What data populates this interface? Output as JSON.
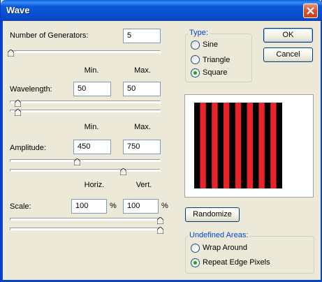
{
  "window": {
    "title": "Wave"
  },
  "generators": {
    "label": "Number of Generators:",
    "value": "5"
  },
  "col_minmax": {
    "min": "Min.",
    "max": "Max."
  },
  "wavelength": {
    "label": "Wavelength:",
    "min": "50",
    "max": "50"
  },
  "amplitude": {
    "label": "Amplitude:",
    "min": "450",
    "max": "750"
  },
  "col_scale": {
    "horiz": "Horiz.",
    "vert": "Vert."
  },
  "scale": {
    "label": "Scale:",
    "horiz": "100",
    "vert": "100",
    "unit": "%"
  },
  "type_group": {
    "title": "Type:",
    "options": [
      "Sine",
      "Triangle",
      "Square"
    ],
    "selected": "Square"
  },
  "buttons": {
    "ok": "OK",
    "cancel": "Cancel",
    "randomize": "Randomize"
  },
  "undefined_group": {
    "title": "Undefined Areas:",
    "options": [
      "Wrap Around",
      "Repeat Edge Pixels"
    ],
    "selected": "Repeat Edge Pixels"
  },
  "preview": {
    "stripe_colors": [
      "#000000",
      "#e8232a"
    ],
    "stripe_count": 15
  },
  "colors": {
    "title_bar": "#0a5fe0",
    "group_title": "#0046d5",
    "radio_dot": "#21a121"
  }
}
